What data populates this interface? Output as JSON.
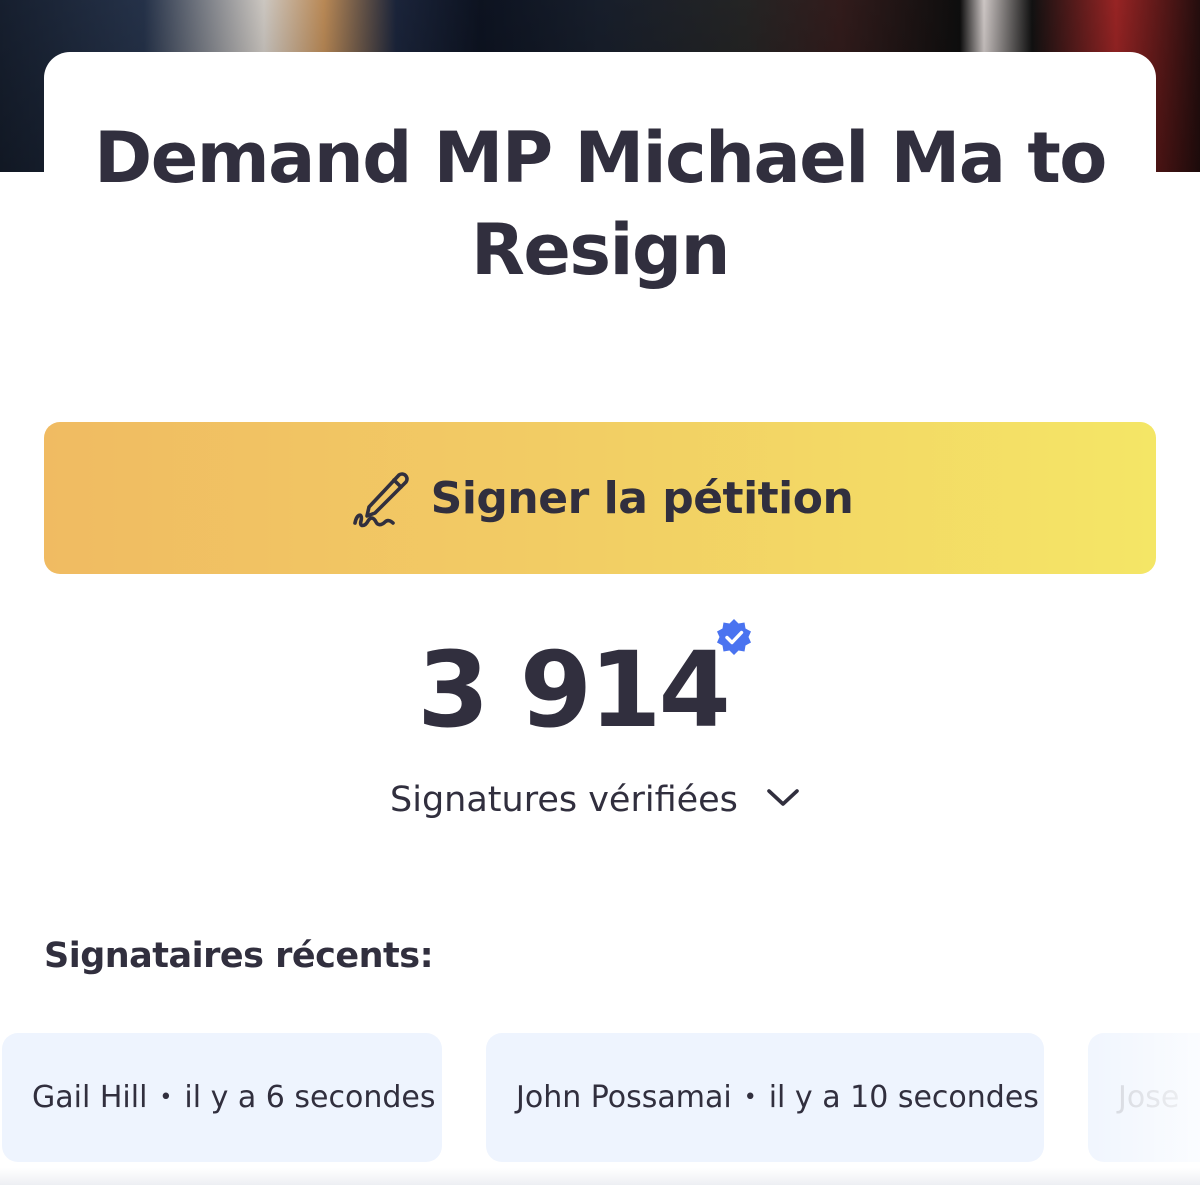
{
  "petition": {
    "title": "Demand MP Michael Ma to Resign"
  },
  "sign_button": {
    "label": "Signer la pétition",
    "icon": "pen-signature-icon"
  },
  "signatures": {
    "count": "3 914",
    "verified_icon": "verified-badge-icon",
    "toggle_label": "Signatures vérifiées",
    "toggle_icon": "chevron-down-icon"
  },
  "recent": {
    "heading": "Signataires récents:",
    "separator": "•",
    "items": [
      {
        "name": "Gail Hill",
        "time": "il y a 6 secondes"
      },
      {
        "name": "John Possamai",
        "time": "il y a 10 secondes"
      },
      {
        "name": "Jose",
        "time": ""
      }
    ]
  },
  "colors": {
    "text": "#312f3e",
    "button_gradient_start": "#f0bb62",
    "button_gradient_end": "#f4e666",
    "verified_blue": "#4a73f0",
    "pill_bg": "#eef4fe"
  }
}
